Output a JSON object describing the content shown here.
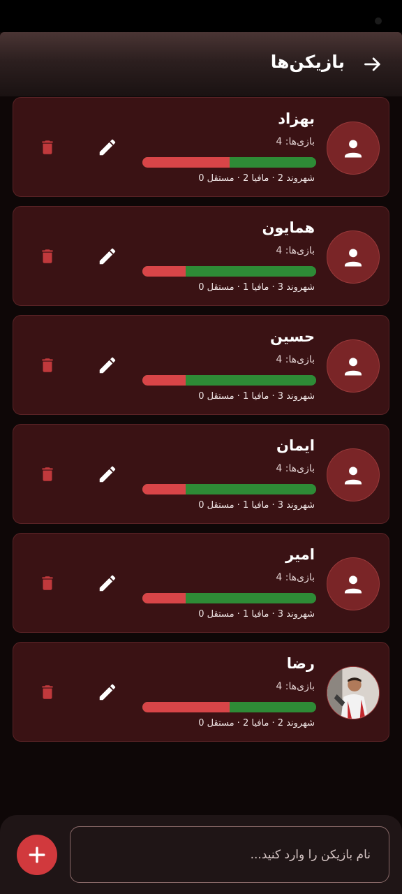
{
  "colors": {
    "background": "#0e0707",
    "card": "#3a1214",
    "accent": "#d1393d",
    "citizen_bar": "#2e8b36",
    "mafia_bar": "#d84548"
  },
  "header": {
    "title": "بازیکن‌ها",
    "back_icon": "arrow-icon"
  },
  "players": [
    {
      "name": "بهزاد",
      "games": "بازی‌ها: 4",
      "stats": "شهروند 2 · مافیا 2 · مستقل 0",
      "mafia_ratio": 0.5,
      "avatar": "person-icon"
    },
    {
      "name": "همایون",
      "games": "بازی‌ها: 4",
      "stats": "شهروند 3 · مافیا 1 · مستقل 0",
      "mafia_ratio": 0.25,
      "avatar": "person-icon"
    },
    {
      "name": "حسین",
      "games": "بازی‌ها: 4",
      "stats": "شهروند 3 · مافیا 1 · مستقل 0",
      "mafia_ratio": 0.25,
      "avatar": "person-icon"
    },
    {
      "name": "ایمان",
      "games": "بازی‌ها: 4",
      "stats": "شهروند 3 · مافیا 1 · مستقل 0",
      "mafia_ratio": 0.25,
      "avatar": "person-icon"
    },
    {
      "name": "امیر",
      "games": "بازی‌ها: 4",
      "stats": "شهروند 3 · مافیا 1 · مستقل 0",
      "mafia_ratio": 0.25,
      "avatar": "person-icon"
    },
    {
      "name": "رضا",
      "games": "بازی‌ها: 4",
      "stats": "شهروند 2 · مافیا 2 · مستقل 0",
      "mafia_ratio": 0.5,
      "avatar": "photo"
    }
  ],
  "actions": {
    "edit_icon": "pencil-icon",
    "delete_icon": "trash-icon"
  },
  "footer": {
    "input_placeholder": "نام بازیکن را وارد کنید...",
    "input_value": "",
    "add_icon": "plus-icon"
  }
}
